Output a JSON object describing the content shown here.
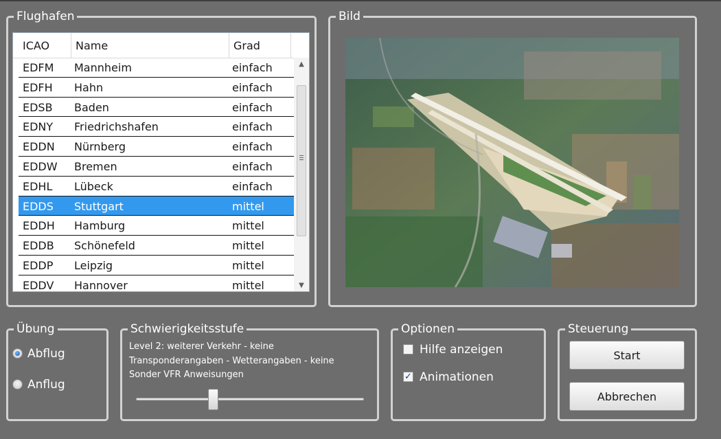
{
  "groups": {
    "flughafen": "Flughafen",
    "bild": "Bild",
    "uebung": "Übung",
    "schwierigkeit": "Schwierigkeitsstufe",
    "optionen": "Optionen",
    "steuerung": "Steuerung"
  },
  "airports": {
    "columns": [
      "ICAO",
      "Name",
      "Grad"
    ],
    "rows": [
      {
        "icao": "EDFM",
        "name": "Mannheim",
        "grad": "einfach"
      },
      {
        "icao": "EDFH",
        "name": "Hahn",
        "grad": "einfach"
      },
      {
        "icao": "EDSB",
        "name": "Baden",
        "grad": "einfach"
      },
      {
        "icao": "EDNY",
        "name": "Friedrichshafen",
        "grad": "einfach"
      },
      {
        "icao": "EDDN",
        "name": "Nürnberg",
        "grad": "einfach"
      },
      {
        "icao": "EDDW",
        "name": "Bremen",
        "grad": "einfach"
      },
      {
        "icao": "EDHL",
        "name": "Lübeck",
        "grad": "einfach"
      },
      {
        "icao": "EDDS",
        "name": "Stuttgart",
        "grad": "mittel",
        "selected": true
      },
      {
        "icao": "EDDH",
        "name": "Hamburg",
        "grad": "mittel"
      },
      {
        "icao": "EDDB",
        "name": "Schönefeld",
        "grad": "mittel"
      },
      {
        "icao": "EDDP",
        "name": "Leipzig",
        "grad": "mittel"
      },
      {
        "icao": "EDDV",
        "name": "Hannover",
        "grad": "mittel"
      }
    ],
    "selected_color": "#3399ee"
  },
  "image": {
    "icon": "aerial-photo-airport"
  },
  "uebung": {
    "options": [
      {
        "label": "Abflug",
        "checked": true
      },
      {
        "label": "Anflug",
        "checked": false
      }
    ]
  },
  "schwierigkeit": {
    "description": "Level 2: weiterer Verkehr - keine Transponderangaben - Wetterangaben - keine Sonder VFR Anweisungen",
    "level_fraction": 0.33
  },
  "optionen": {
    "hilfe": {
      "label": "Hilfe anzeigen",
      "checked": false
    },
    "animationen": {
      "label": "Animationen",
      "checked": true
    }
  },
  "steuerung": {
    "start": "Start",
    "abbrechen": "Abbrechen"
  },
  "colors": {
    "background": "#6d6d6d",
    "group_border": "#d2d2d2",
    "selection": "#3399ee"
  }
}
